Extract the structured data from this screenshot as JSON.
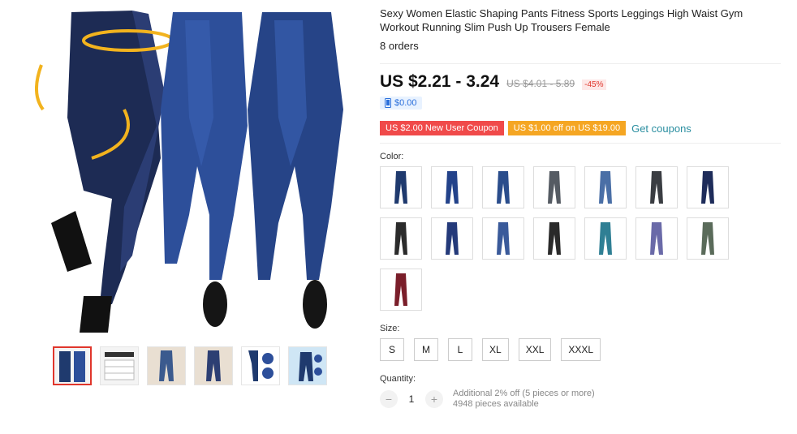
{
  "product": {
    "title": "Sexy Women Elastic Shaping Pants Fitness Sports Leggings High Waist Gym Workout Running Slim Push Up Trousers Female",
    "orders": "8 orders"
  },
  "price": {
    "current": "US $2.21 - 3.24",
    "original": "US $4.01 - 5.89",
    "discount": "-45%",
    "mobile_price": "$0.00"
  },
  "coupons": {
    "new_user": "US $2.00 New User Coupon",
    "off": "US $1.00 off on US $19.00",
    "get_label": "Get coupons"
  },
  "color": {
    "label": "Color:",
    "swatch_colors": [
      "#1f3a6e",
      "#23428a",
      "#2a4d8c",
      "#555b63",
      "#4a6fa6",
      "#3a3d42",
      "#1e2c5a",
      "#2b2b2b",
      "#243a7a",
      "#3a5a9a",
      "#2a2a2a",
      "#2f7f94",
      "#6a6aa8",
      "#5a6b5a",
      "#7a1e2a"
    ]
  },
  "size": {
    "label": "Size:",
    "options": [
      "S",
      "M",
      "L",
      "XL",
      "XXL",
      "XXXL"
    ]
  },
  "quantity": {
    "label": "Quantity:",
    "value": "1",
    "minus": "−",
    "plus": "+",
    "bulk": "Additional 2% off (5 pieces or more)",
    "available": "4948 pieces available"
  },
  "gallery": {
    "thumb_colors": [
      "#1f3a6e",
      "#dcdcdc",
      "#3b5a8e",
      "#2d3f73",
      "#1f3a6e",
      "#9ec6e6"
    ]
  }
}
